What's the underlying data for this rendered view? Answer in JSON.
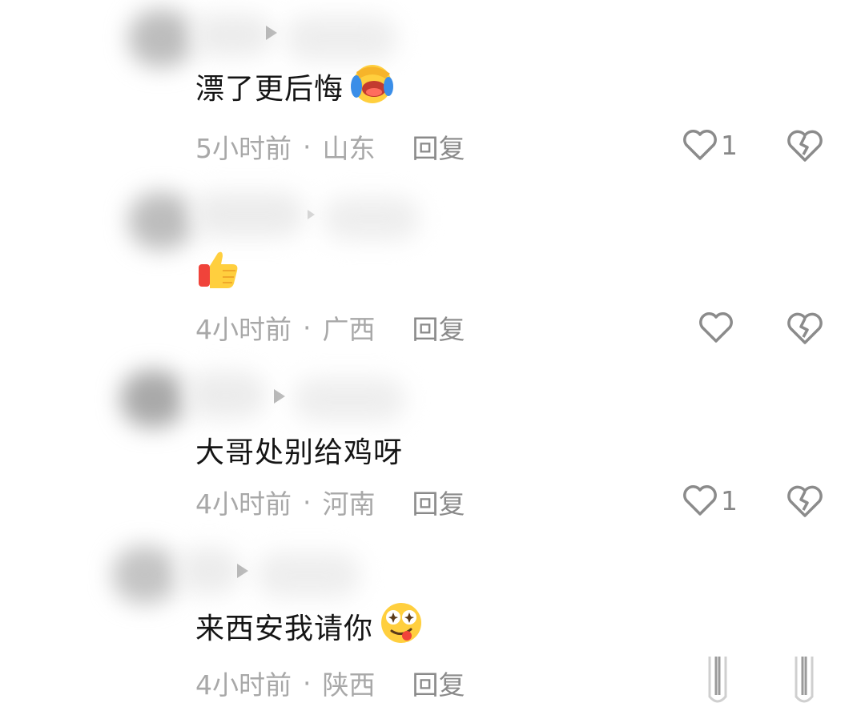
{
  "comments": [
    {
      "text": "漂了更后悔",
      "emoji": "face-palm-laughing",
      "time": "5小时前",
      "sep": "·",
      "location": "山东",
      "reply_label": "回复",
      "like_count": "1"
    },
    {
      "text": "",
      "emoji": "thumbs-up",
      "time": "4小时前",
      "sep": "·",
      "location": "广西",
      "reply_label": "回复",
      "like_count": ""
    },
    {
      "text": "大哥处别给鸡呀",
      "emoji": "",
      "time": "4小时前",
      "sep": "·",
      "location": "河南",
      "reply_label": "回复",
      "like_count": "1"
    },
    {
      "text": "来西安我请你",
      "emoji": "starry-eyes-tongue",
      "time": "4小时前",
      "sep": "·",
      "location": "陕西",
      "reply_label": "回复",
      "like_count": ""
    }
  ],
  "icons": {
    "like": "heart-outline-icon",
    "dislike": "broken-heart-icon",
    "scroll": "scroll-indicator-icon"
  },
  "colors": {
    "text": "#151515",
    "meta": "#a8a8a8",
    "icon": "#888888"
  }
}
